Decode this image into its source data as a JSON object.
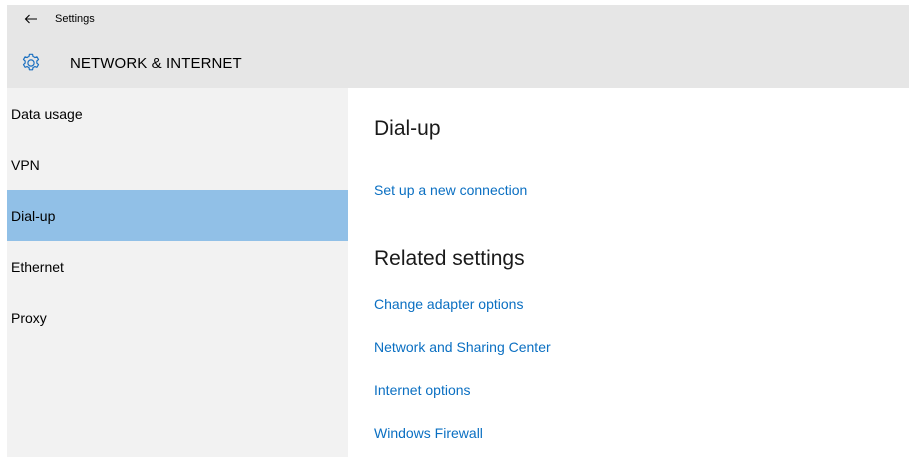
{
  "window": {
    "title": "Settings",
    "back_icon": "back-arrow-icon"
  },
  "header": {
    "icon": "gear-icon",
    "title": "NETWORK & INTERNET"
  },
  "sidebar": {
    "items": [
      {
        "label": "Data usage",
        "selected": false
      },
      {
        "label": "VPN",
        "selected": false
      },
      {
        "label": "Dial-up",
        "selected": true
      },
      {
        "label": "Ethernet",
        "selected": false
      },
      {
        "label": "Proxy",
        "selected": false
      }
    ]
  },
  "main": {
    "title": "Dial-up",
    "setup_link": "Set up a new connection",
    "related": {
      "title": "Related settings",
      "links": [
        "Change adapter options",
        "Network and Sharing Center",
        "Internet options",
        "Windows Firewall"
      ]
    }
  },
  "colors": {
    "accent": "#0a6fc2",
    "selected_bg": "#91c0e7",
    "sidebar_bg": "#f2f2f2",
    "titlebar_bg": "#e6e6e6"
  }
}
